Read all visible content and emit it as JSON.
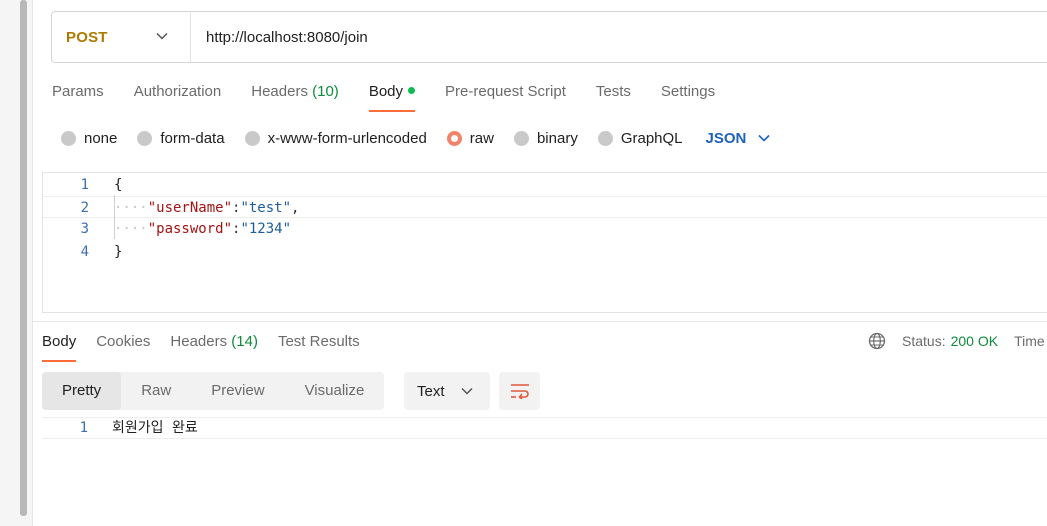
{
  "request": {
    "method": "POST",
    "url": "http://localhost:8080/join"
  },
  "request_tabs": [
    {
      "label": "Params",
      "count": ""
    },
    {
      "label": "Authorization",
      "count": ""
    },
    {
      "label": "Headers",
      "count": "(10)"
    },
    {
      "label": "Body",
      "count": ""
    },
    {
      "label": "Pre-request Script",
      "count": ""
    },
    {
      "label": "Tests",
      "count": ""
    },
    {
      "label": "Settings",
      "count": ""
    }
  ],
  "active_request_tab": "Body",
  "body_types": [
    "none",
    "form-data",
    "x-www-form-urlencoded",
    "raw",
    "binary",
    "GraphQL"
  ],
  "selected_body_type": "raw",
  "body_format": "JSON",
  "editor": {
    "line_numbers": [
      "1",
      "2",
      "3",
      "4"
    ],
    "open_brace": "{",
    "close_brace": "}",
    "fields": [
      {
        "key": "\"userName\"",
        "value": "\"test\"",
        "trailing": ","
      },
      {
        "key": "\"password\"",
        "value": "\"1234\"",
        "trailing": ""
      }
    ]
  },
  "response_tabs": [
    {
      "label": "Body",
      "count": ""
    },
    {
      "label": "Cookies",
      "count": ""
    },
    {
      "label": "Headers",
      "count": "(14)"
    },
    {
      "label": "Test Results",
      "count": ""
    }
  ],
  "status": {
    "label": "Status:",
    "value": "200 OK",
    "time_label": "Time"
  },
  "view_modes": [
    "Pretty",
    "Raw",
    "Preview",
    "Visualize"
  ],
  "active_view_mode": "Pretty",
  "response_format": "Text",
  "response_body": {
    "line_number": "1",
    "content": "회원가입 완료"
  },
  "colors": {
    "method": "#ad7a03",
    "accent": "#ff6c37",
    "status_ok": "#0f8a3c",
    "json_select": "#1e63b8"
  }
}
